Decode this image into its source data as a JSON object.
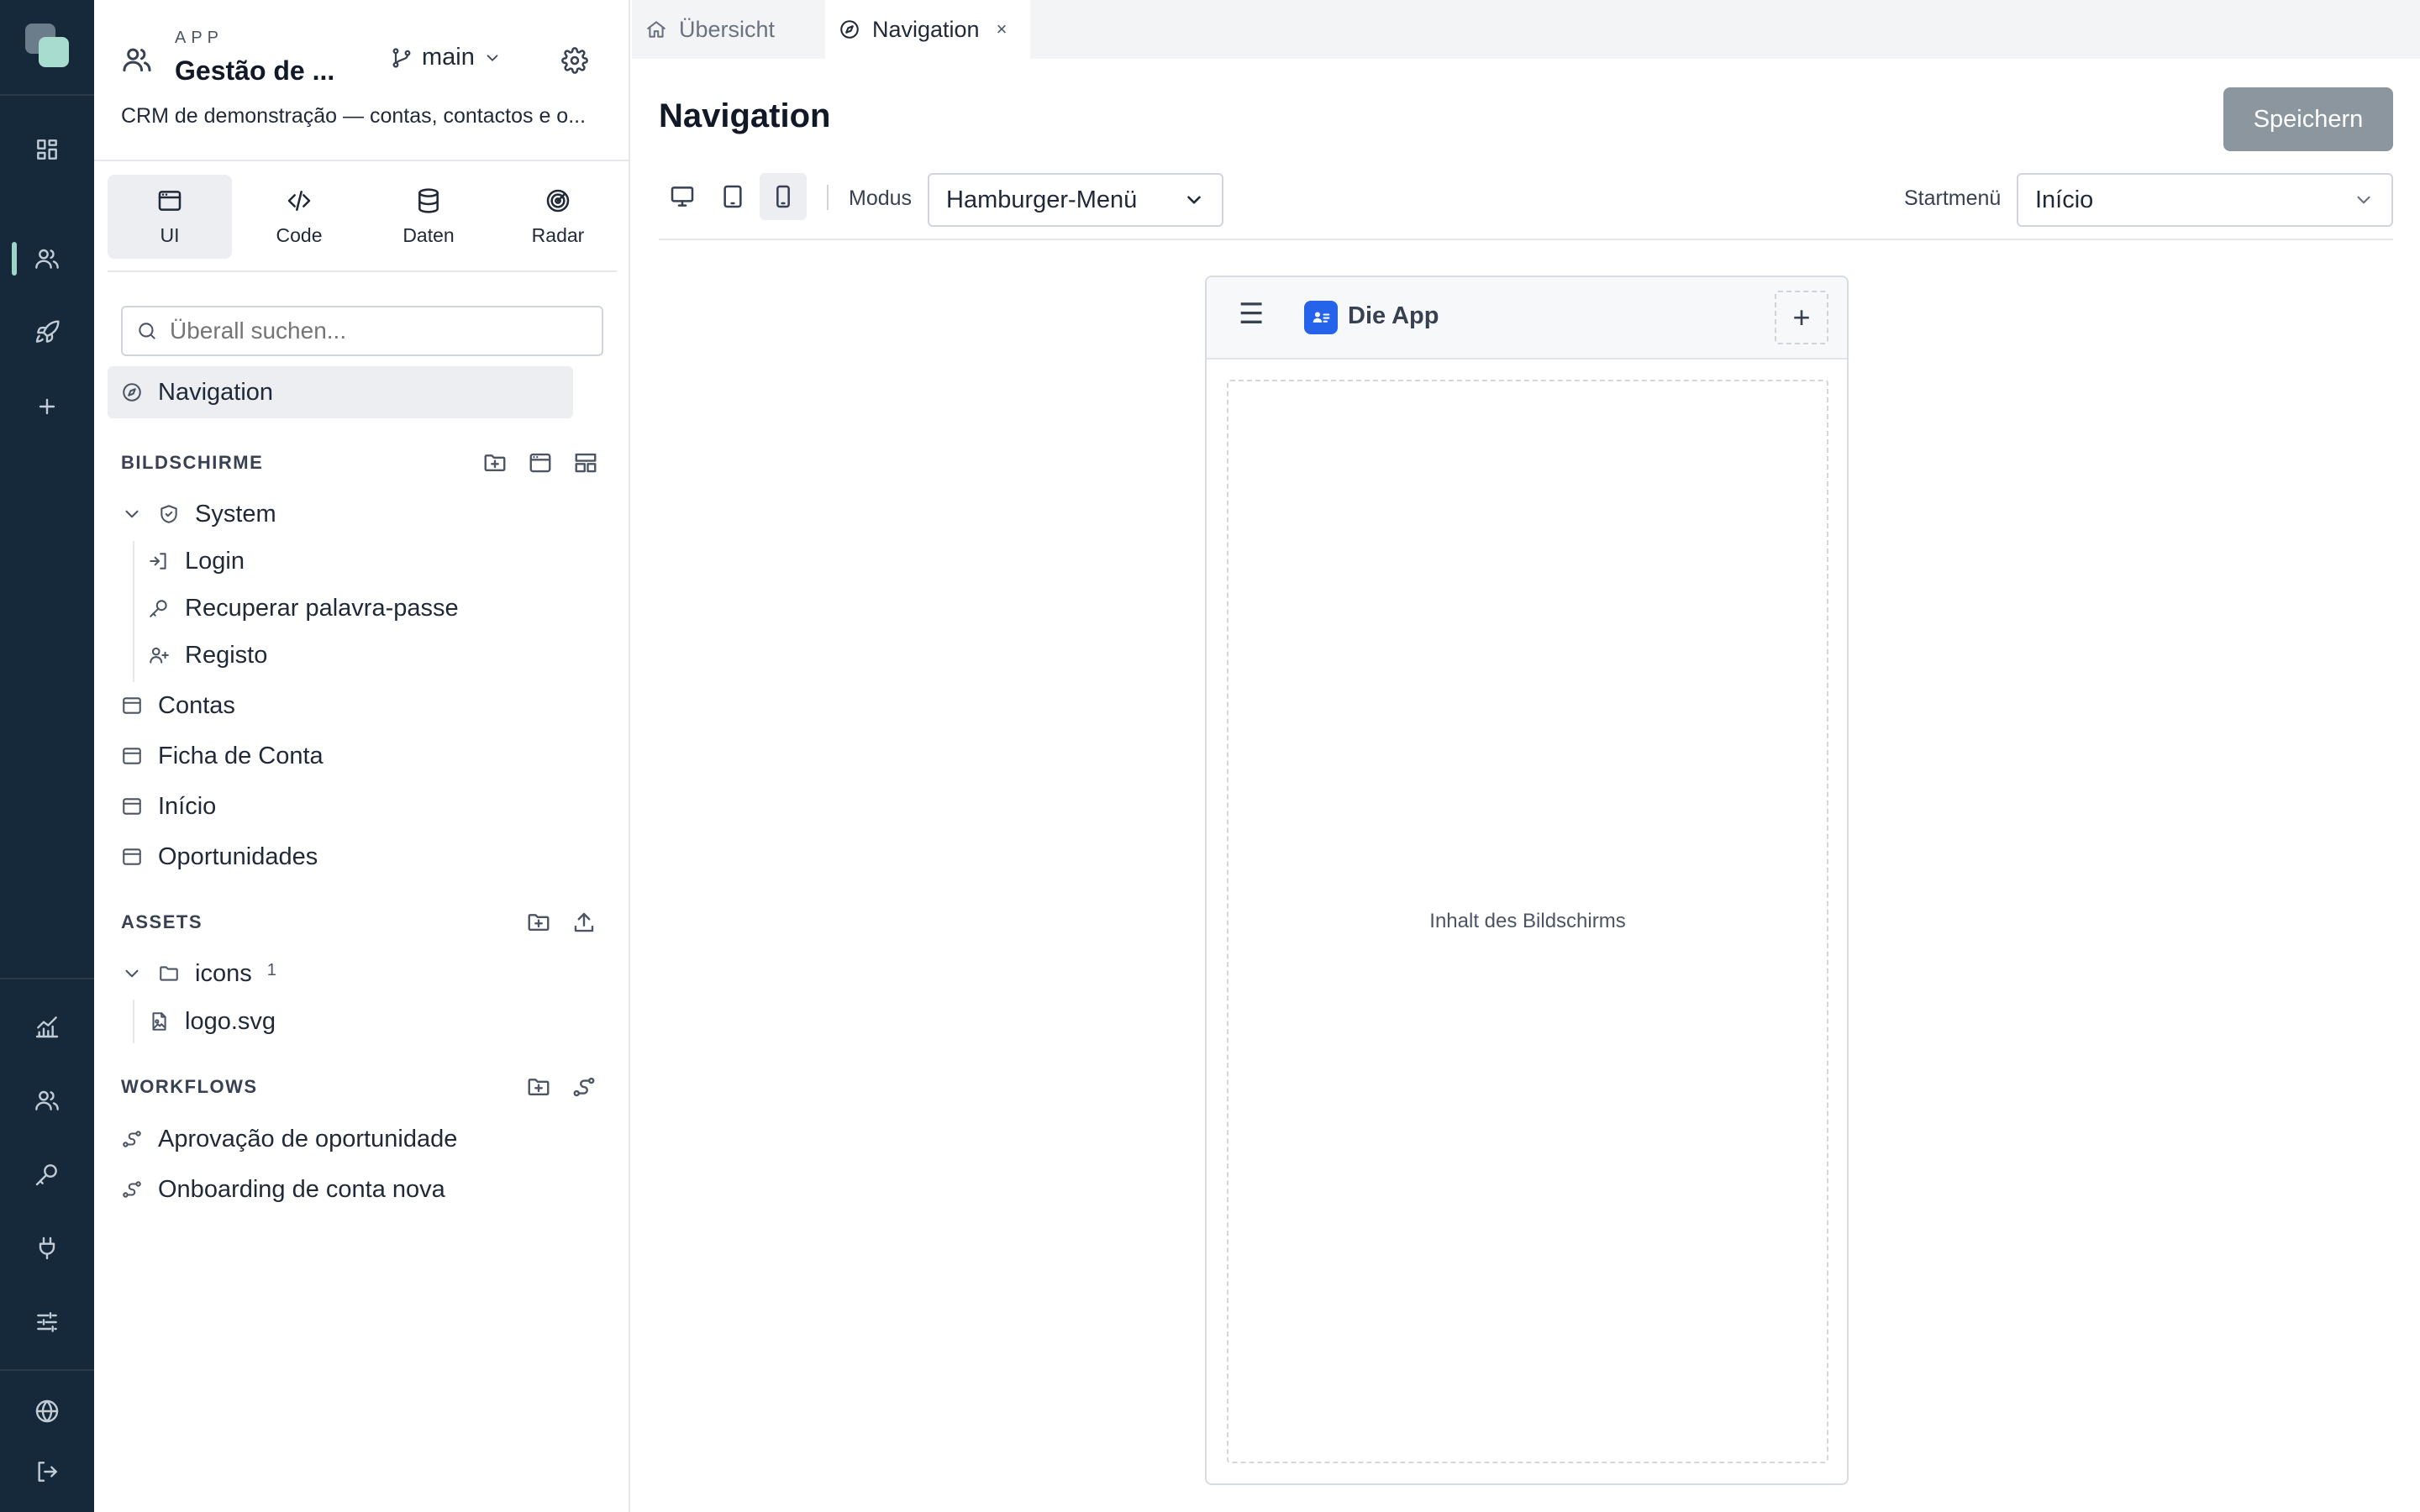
{
  "app": {
    "kind_label": "APP",
    "name": "Gestão de ...",
    "description": "CRM de demonstração — contas, contactos e o...",
    "branch": "main"
  },
  "rail": {
    "icons": [
      "dashboard-icon",
      "users-icon",
      "rocket-icon",
      "plus-icon",
      "chart-icon",
      "team-icon",
      "key-icon",
      "plug-icon",
      "sliders-icon",
      "globe-icon",
      "logout-icon"
    ]
  },
  "mode_tabs": [
    {
      "label": "UI",
      "icon": "window-icon"
    },
    {
      "label": "Code",
      "icon": "code-icon"
    },
    {
      "label": "Daten",
      "icon": "database-icon"
    },
    {
      "label": "Radar",
      "icon": "radar-icon"
    }
  ],
  "search": {
    "placeholder": "Überall suchen..."
  },
  "nav_item": {
    "label": "Navigation"
  },
  "sections": {
    "screens": {
      "title": "BILDSCHIRME",
      "system": {
        "label": "System",
        "children": [
          {
            "label": "Login",
            "icon": "login-icon"
          },
          {
            "label": "Recuperar palavra-passe",
            "icon": "key-icon"
          },
          {
            "label": "Registo",
            "icon": "user-plus-icon"
          }
        ]
      },
      "items": [
        {
          "label": "Contas"
        },
        {
          "label": "Ficha de Conta"
        },
        {
          "label": "Início"
        },
        {
          "label": "Oportunidades"
        }
      ]
    },
    "assets": {
      "title": "ASSETS",
      "folder": {
        "label": "icons",
        "count": "1"
      },
      "files": [
        {
          "label": "logo.svg"
        }
      ]
    },
    "workflows": {
      "title": "WORKFLOWS",
      "items": [
        {
          "label": "Aprovação de oportunidade"
        },
        {
          "label": "Onboarding de conta nova"
        }
      ]
    }
  },
  "tabs": [
    {
      "label": "Übersicht",
      "icon": "home-icon",
      "active": false
    },
    {
      "label": "Navigation",
      "icon": "compass-icon",
      "active": true,
      "close": "×"
    }
  ],
  "page": {
    "title": "Navigation",
    "save_label": "Speichern",
    "mode_label": "Modus",
    "mode_value": "Hamburger-Menü",
    "start_label": "Startmenü",
    "start_value": "Início"
  },
  "preview": {
    "menu_glyph": "☰",
    "app_name": "Die App",
    "add_glyph": "+",
    "content_placeholder": "Inhalt des Bildschirms"
  },
  "colors": {
    "rail_bg": "#16293a",
    "accent": "#9dd4c8",
    "save_button": "#8c969f",
    "app_badge": "#2563eb"
  }
}
